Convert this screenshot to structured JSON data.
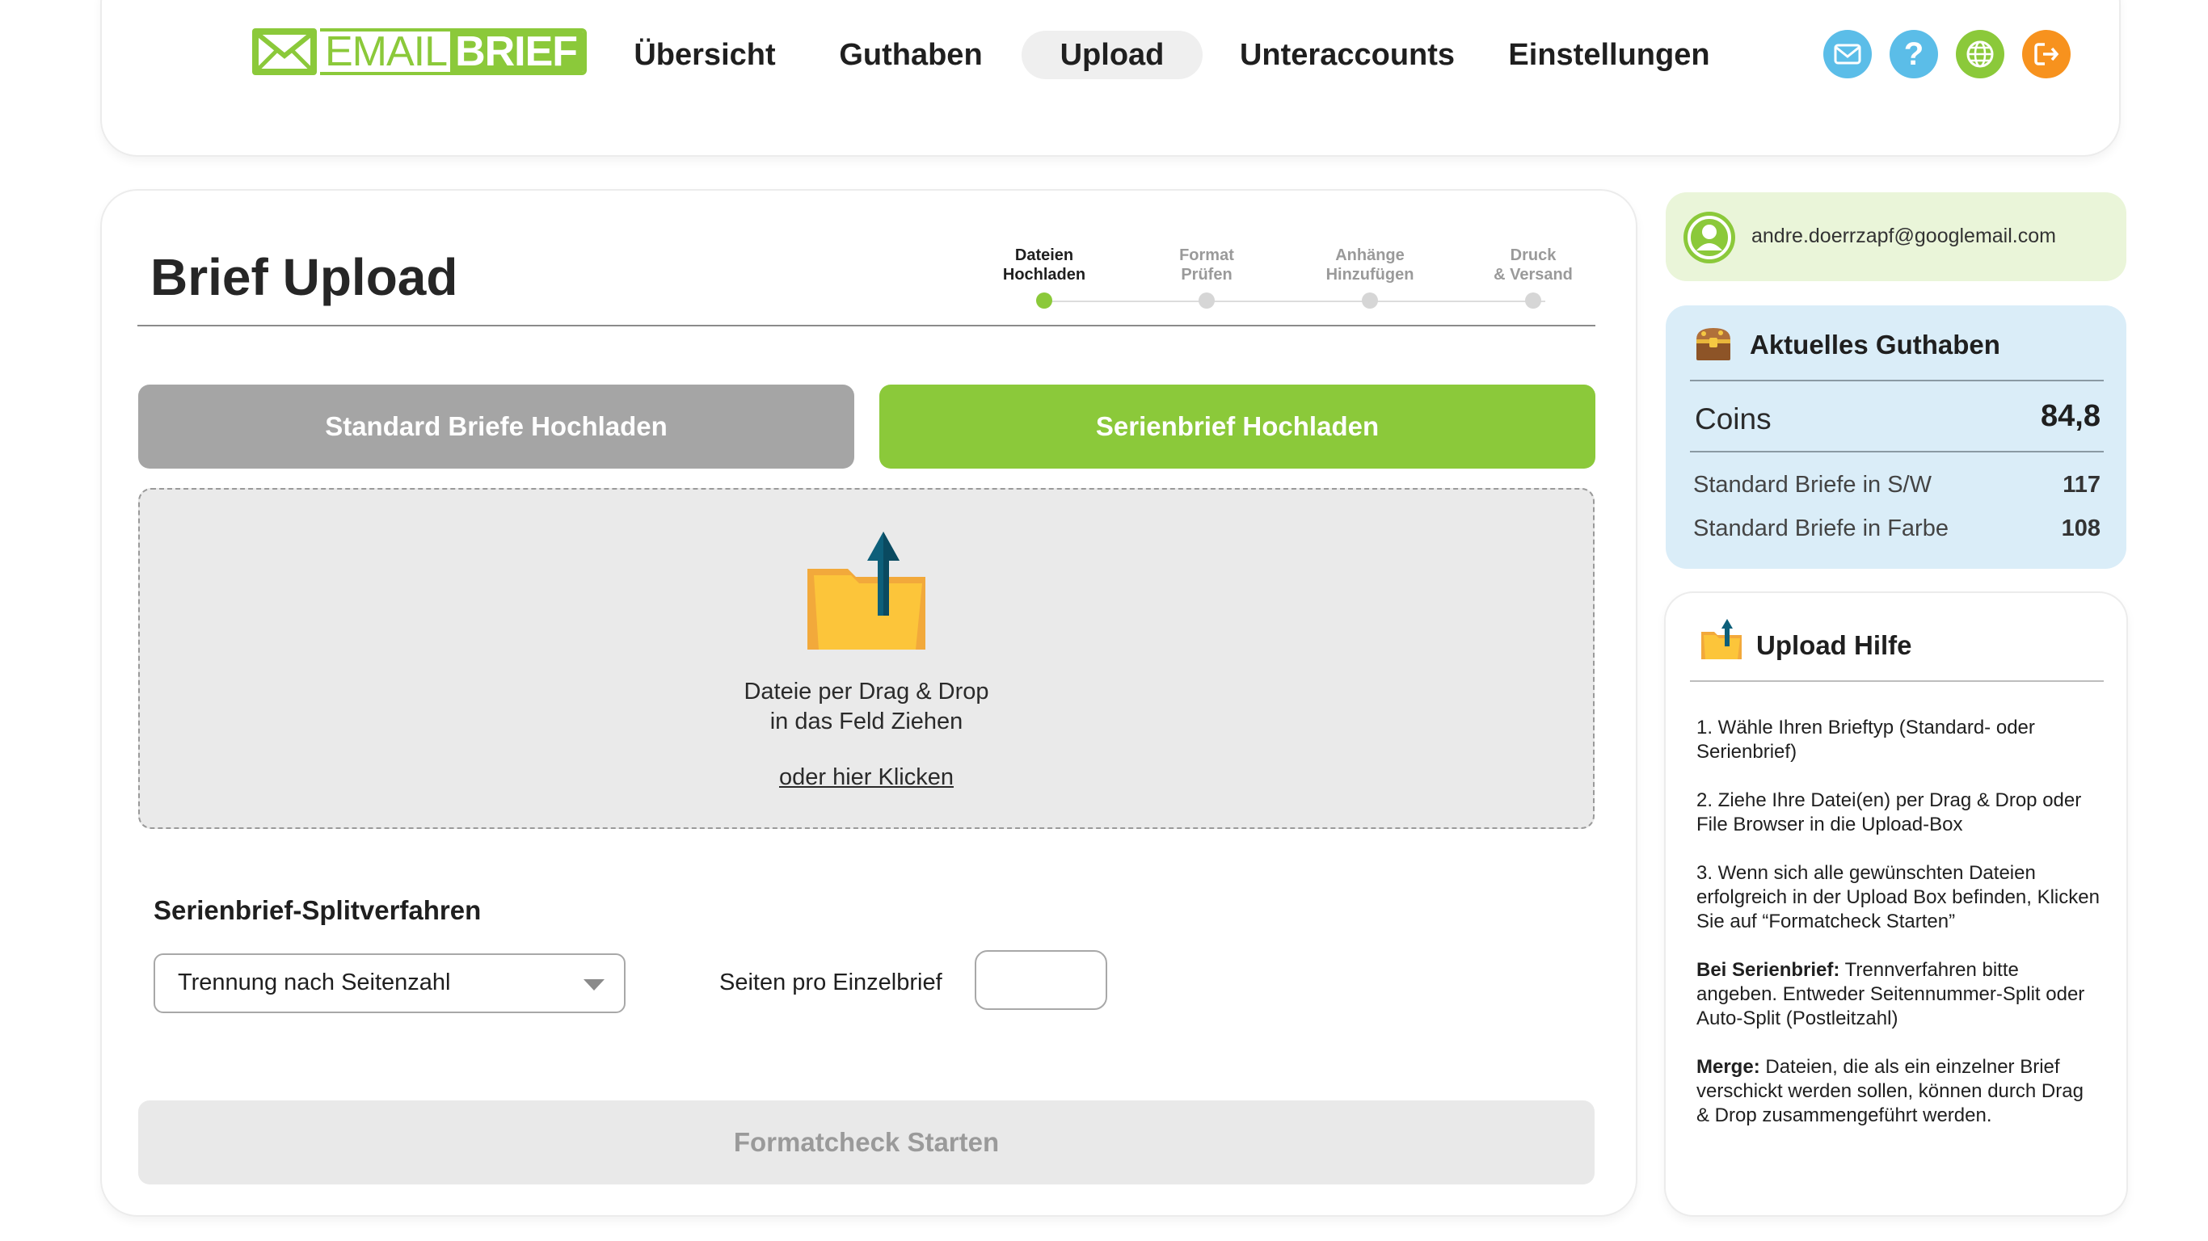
{
  "brand": {
    "part1": "EMAIL",
    "part2": "BRIEF",
    "accent": "#8bc93a"
  },
  "nav": {
    "items": [
      {
        "label": "Übersicht"
      },
      {
        "label": "Guthaben"
      },
      {
        "label": "Upload",
        "active": true
      },
      {
        "label": "Unteraccounts"
      },
      {
        "label": "Einstellungen"
      }
    ],
    "icons": [
      {
        "name": "mail-icon",
        "color": "#5bbde8"
      },
      {
        "name": "help-icon",
        "color": "#5bbde8"
      },
      {
        "name": "globe-icon",
        "color": "#8bc93a"
      },
      {
        "name": "logout-icon",
        "color": "#f7921e"
      }
    ]
  },
  "main": {
    "title": "Brief Upload",
    "steps": [
      {
        "line1": "Dateien",
        "line2": "Hochladen",
        "active": true
      },
      {
        "line1": "Format",
        "line2": "Prüfen",
        "active": false
      },
      {
        "line1": "Anhänge",
        "line2": "Hinzufügen",
        "active": false
      },
      {
        "line1": "Druck",
        "line2": "& Versand",
        "active": false
      }
    ],
    "btn_standard": "Standard Briefe Hochladen",
    "btn_serien": "Serienbrief Hochladen",
    "dropzone": {
      "line1": "Dateie per Drag & Drop",
      "line2": "in das Feld Ziehen",
      "link": "oder hier Klicken"
    },
    "split_title": "Serienbrief-Splitverfahren",
    "split_select_value": "Trennung nach Seitenzahl",
    "pages_label": "Seiten pro Einzelbrief",
    "pages_value": "",
    "btn_formatcheck": "Formatcheck Starten"
  },
  "user": {
    "email": "andre.doerrzapf@googlemail.com"
  },
  "balance": {
    "title": "Aktuelles Guthaben",
    "coins_label": "Coins",
    "coins_value": "84,8",
    "rows": [
      {
        "label": "Standard Briefe in S/W",
        "value": "117"
      },
      {
        "label": "Standard Briefe in Farbe",
        "value": "108"
      }
    ]
  },
  "help": {
    "title": "Upload Hilfe",
    "item1": "1. Wähle Ihren Brieftyp (Standard- oder Serienbrief)",
    "item2": "2. Ziehe Ihre Datei(en) per Drag & Drop oder File Browser in die Upload-Box",
    "item3": "3. Wenn sich alle gewünschten Dateien erfolgreich in der Upload Box befinden, Klicken Sie auf “Formatcheck Starten”",
    "item4_bold": "Bei Serienbrief:",
    "item4_text": " Trennverfahren bitte angeben. Entweder Seitennummer-Split oder Auto-Split (Postleitzahl)",
    "item5_bold": "Merge:",
    "item5_text": " Dateien, die als ein einzelner Brief verschickt werden sollen, können durch Drag & Drop zusammengeführt werden."
  }
}
